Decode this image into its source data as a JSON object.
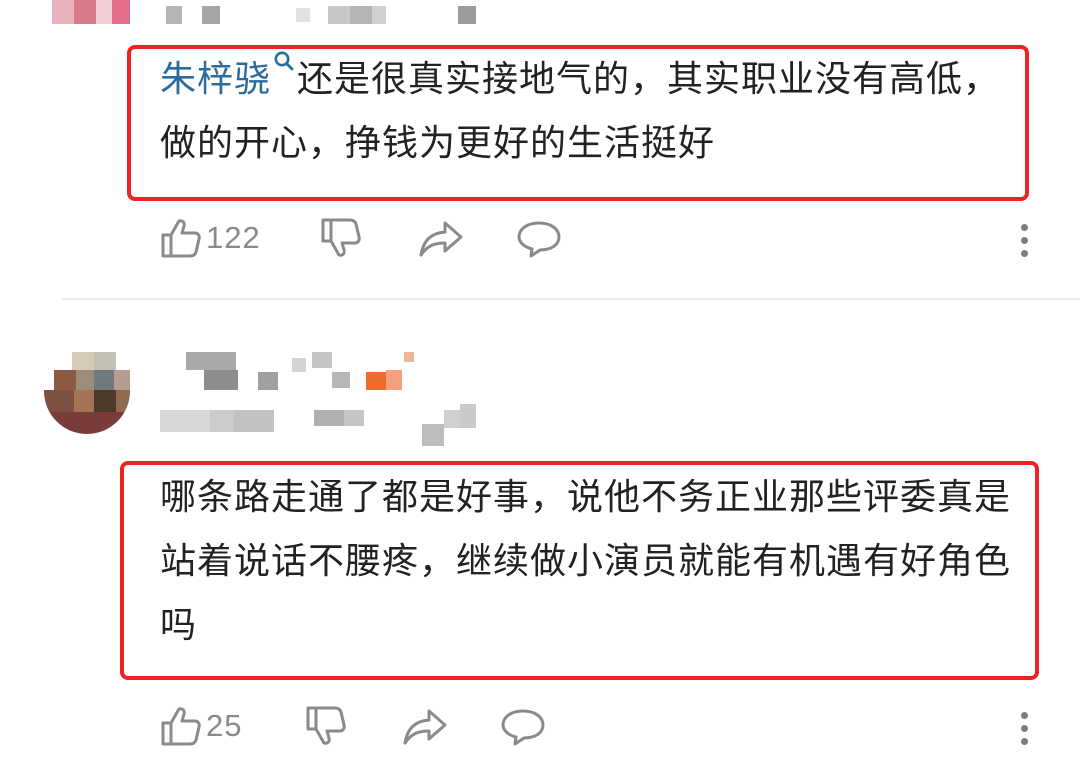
{
  "comments": [
    {
      "mention": "朱梓骁",
      "text": "还是很真实接地气的，其实职业没有高低，做的开心，挣钱为更好的生活挺好",
      "likes": "122"
    },
    {
      "text": "哪条路走通了都是好事，说他不务正业那些评委真是站着说话不腰疼，继续做小演员就能有机遇有好角色吗",
      "likes": "25"
    }
  ],
  "icons": {
    "like": "thumbs-up-icon",
    "dislike": "thumbs-down-icon",
    "share": "share-icon",
    "reply": "comment-bubble-icon",
    "more": "more-vertical-icon"
  },
  "colors": {
    "highlight": "#ee2222",
    "mention": "#2a6c9d",
    "icon": "#8a8a8a"
  }
}
